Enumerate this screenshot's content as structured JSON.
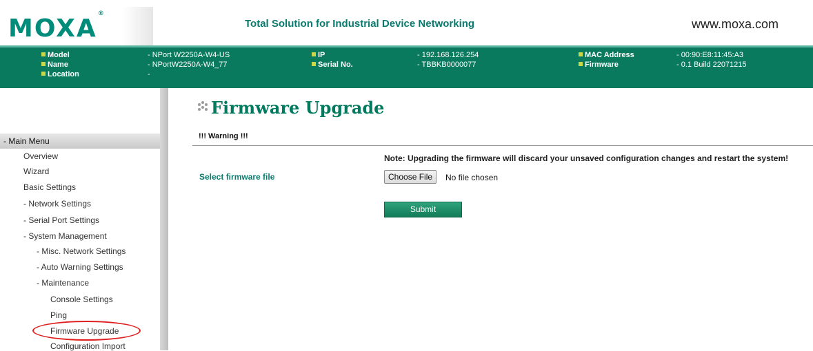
{
  "header": {
    "logo_text": "MOXA",
    "logo_reg": "®",
    "tagline": "Total Solution for Industrial Device Networking",
    "url": "www.moxa.com"
  },
  "info": {
    "model_label": "Model",
    "model_value": "- NPort W2250A-W4-US",
    "name_label": "Name",
    "name_value": "- NPortW2250A-W4_77",
    "location_label": "Location",
    "location_value": "-",
    "ip_label": "IP",
    "ip_value": "- 192.168.126.254",
    "serial_label": "Serial No.",
    "serial_value": "- TBBKB0000077",
    "mac_label": "MAC Address",
    "mac_value": "- 00:90:E8:11:45:A3",
    "firmware_label": "Firmware",
    "firmware_value": "- 0.1 Build 22071215"
  },
  "menu": {
    "header": "- Main Menu",
    "items": [
      "Overview",
      "Wizard",
      "Basic Settings",
      "- Network Settings",
      "- Serial Port Settings",
      "- System Management",
      "- Misc. Network Settings",
      "- Auto Warning Settings",
      "- Maintenance",
      "Console Settings",
      "Ping",
      "Firmware Upgrade",
      "Configuration Import"
    ]
  },
  "main": {
    "title": "Firmware Upgrade",
    "warning": "!!! Warning !!!",
    "note": "Note: Upgrading the firmware will discard your unsaved configuration changes and restart the system!",
    "select_label": "Select firmware file",
    "choose_file_label": "Choose File",
    "no_file_text": "No file chosen",
    "submit_label": "Submit"
  },
  "colors": {
    "brand_green": "#0a7a5e",
    "accent_teal": "#0b7a6e",
    "highlight_red": "#e02020"
  }
}
